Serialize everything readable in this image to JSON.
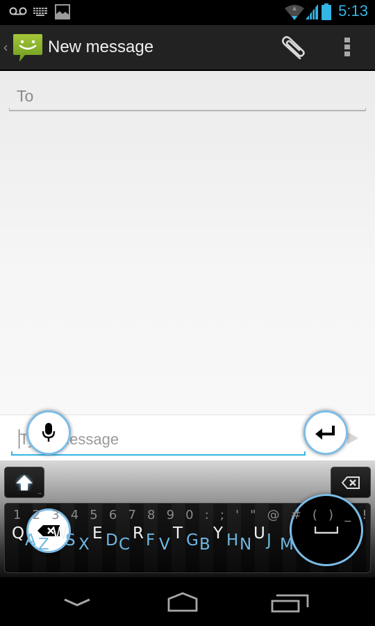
{
  "status_bar": {
    "time": "5:13",
    "icons": [
      "voicemail-icon",
      "keyboard-icon",
      "picture-icon",
      "wifi-icon",
      "signal-icon",
      "battery-icon"
    ],
    "accent_color": "#33b5e5"
  },
  "action_bar": {
    "title": "New message",
    "up_glyph": "‹",
    "icons": [
      "messaging-app-icon",
      "attachment-icon",
      "overflow-menu-icon"
    ]
  },
  "compose": {
    "to_placeholder": "To",
    "message_placeholder": "Type message",
    "message_value": ""
  },
  "keyboard": {
    "number_row": "1 2 3 4 5 6 7 8 9 0 : ; ' \" @ # ( ) _ ! ,",
    "letters": [
      {
        "char": "Q",
        "style": "white"
      },
      {
        "char": "A",
        "style": "blue"
      },
      {
        "char": "Z",
        "style": "blue"
      },
      {
        "char": "W",
        "style": "white"
      },
      {
        "char": "S",
        "style": "blue"
      },
      {
        "char": "X",
        "style": "blue"
      },
      {
        "char": "E",
        "style": "white"
      },
      {
        "char": "D",
        "style": "blue"
      },
      {
        "char": "C",
        "style": "blue"
      },
      {
        "char": "R",
        "style": "white"
      },
      {
        "char": "F",
        "style": "blue"
      },
      {
        "char": "V",
        "style": "blue"
      },
      {
        "char": "T",
        "style": "white"
      },
      {
        "char": "G",
        "style": "blue"
      },
      {
        "char": "B",
        "style": "blue"
      },
      {
        "char": "Y",
        "style": "white"
      },
      {
        "char": "H",
        "style": "blue"
      },
      {
        "char": "N",
        "style": "blue"
      },
      {
        "char": "U",
        "style": "white"
      },
      {
        "char": "J",
        "style": "blue"
      },
      {
        "char": "M",
        "style": "blue"
      }
    ],
    "shift_dots": "...",
    "bubbles": [
      "mic-icon",
      "enter-icon",
      "backspace-icon",
      "space-icon"
    ],
    "letter_blue": "#6fb7e2",
    "bubble_ring": "#7cbde8"
  },
  "nav_bar": {
    "buttons": [
      "back-icon",
      "home-icon",
      "recent-apps-icon"
    ]
  }
}
